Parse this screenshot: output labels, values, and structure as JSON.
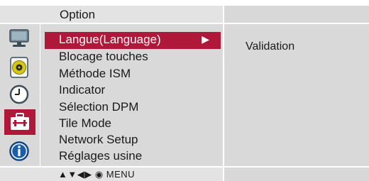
{
  "header": {
    "title": "Option"
  },
  "menu": {
    "items": [
      {
        "label": "Langue(Language)",
        "selected": true
      },
      {
        "label": "Blocage touches",
        "selected": false
      },
      {
        "label": "Méthode ISM",
        "selected": false
      },
      {
        "label": "Indicator",
        "selected": false
      },
      {
        "label": "Sélection DPM",
        "selected": false
      },
      {
        "label": "Tile Mode",
        "selected": false
      },
      {
        "label": "Network Setup",
        "selected": false
      },
      {
        "label": "Réglages usine",
        "selected": false
      }
    ],
    "selected_arrow": "▶"
  },
  "panel": {
    "value": "Validation"
  },
  "footer": {
    "nav_hint": "▲▼◀▶ ◉ MENU"
  },
  "rail_icons": [
    "monitor-icon",
    "disc-icon",
    "clock-icon",
    "toolbox-icon",
    "info-icon"
  ],
  "colors": {
    "accent": "#b0183a",
    "background": "#d9d9d9",
    "header": "#e3e3e3"
  }
}
